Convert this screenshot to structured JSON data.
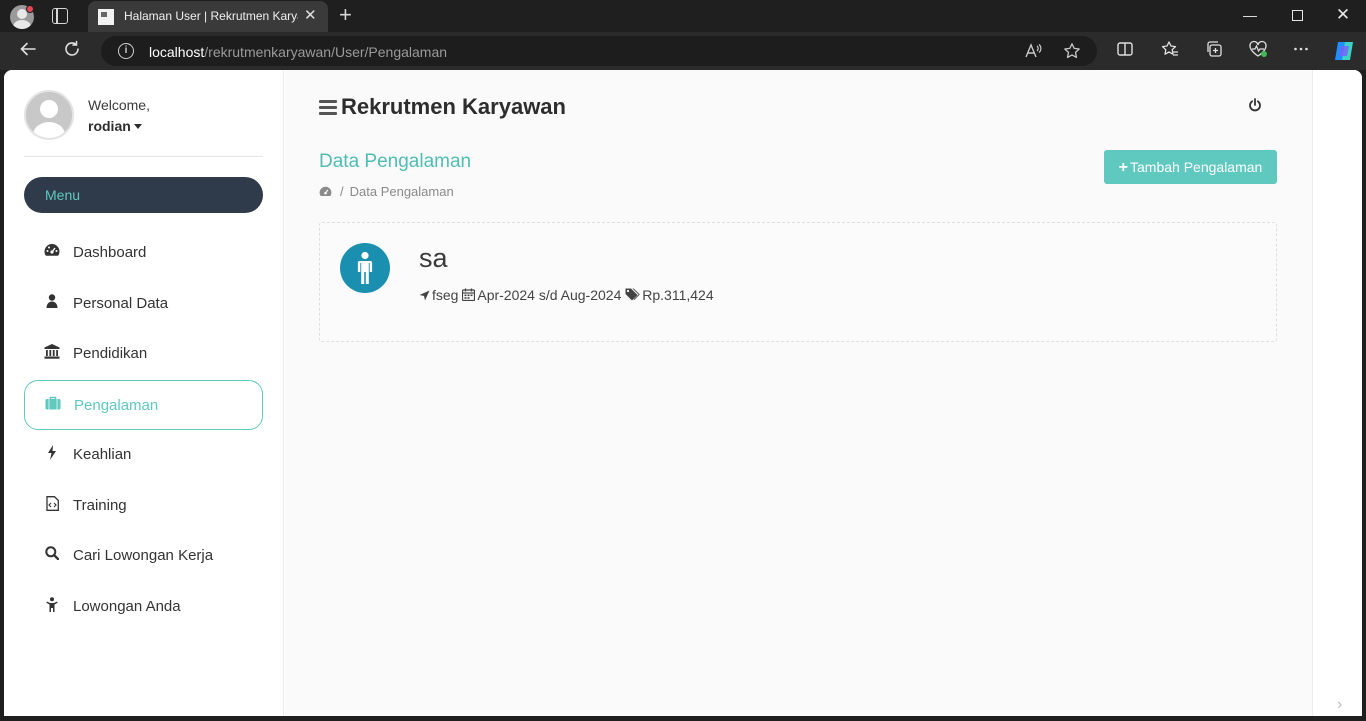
{
  "browser": {
    "tab_title": "Halaman User | Rekrutmen Karyawan",
    "tab_close": "✕",
    "new_tab": "+",
    "url_host": "localhost",
    "url_path": "/rekrutmenkaryawan/User/Pengalaman",
    "win_min": "—",
    "win_close": "✕",
    "icons": [
      "back-icon",
      "refresh-icon",
      "info-icon",
      "read-aloud-icon",
      "favorite-icon",
      "split-screen-icon",
      "favorites-icon",
      "collections-icon",
      "health-icon",
      "more-icon",
      "copilot-icon"
    ]
  },
  "sidebar": {
    "welcome": "Welcome,",
    "username": "rodian",
    "menu_header": "Menu",
    "items": [
      {
        "label": "Dashboard",
        "icon": "dashboard-icon"
      },
      {
        "label": "Personal Data",
        "icon": "user-icon"
      },
      {
        "label": "Pendidikan",
        "icon": "institution-icon"
      },
      {
        "label": "Pengalaman",
        "icon": "briefcase-icon",
        "active": true
      },
      {
        "label": "Keahlian",
        "icon": "bolt-icon"
      },
      {
        "label": "Training",
        "icon": "file-code-icon"
      },
      {
        "label": "Cari Lowongan Kerja",
        "icon": "search-icon"
      },
      {
        "label": "Lowongan Anda",
        "icon": "child-icon"
      }
    ]
  },
  "header": {
    "app_title": "Rekrutmen Karyawan"
  },
  "content": {
    "section_title": "Data Pengalaman",
    "breadcrumb_sep": "/",
    "breadcrumb_current": "Data Pengalaman",
    "add_button_label": "Tambah Pengalaman",
    "add_button_plus": "+",
    "experience": {
      "name": "sa",
      "location": "fseg",
      "period": "Apr-2024 s/d Aug-2024",
      "salary": "Rp.311,424"
    }
  },
  "colors": {
    "accent": "#5fc9c0",
    "menu_pill": "#2f3a4b",
    "experience_icon": "#1a8fb0"
  },
  "scroll_arrow": "›"
}
